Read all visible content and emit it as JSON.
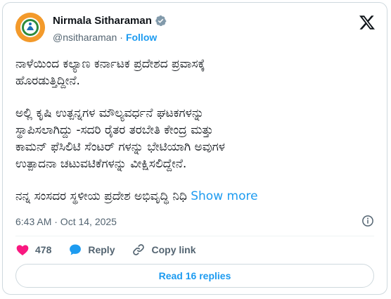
{
  "author": {
    "name": "Nirmala Sitharaman",
    "handle": "@nsitharaman",
    "separator": "·",
    "follow_label": "Follow"
  },
  "post": {
    "paragraphs": [
      "ನಾಳೆಯಿಂದ ಕಲ್ಯಾಣ ಕರ್ನಾಟಕ ಪ್ರದೇಶದ ಪ್ರವಾಸಕ್ಕೆ\nಹೊರಡುತ್ತಿದ್ದೀನೆ.",
      "ಅಲ್ಲಿ ಕೃಷಿ ಉತ್ಪನ್ನಗಳ ಮೌಲ್ಯವರ್ಧನೆ ಘಟಕಗಳನ್ನು\nಸ್ಥಾಪಿಸಲಾಗಿದ್ದು -ಸದರಿ ರೈತರ ತರಬೇತಿ ಕೇಂದ್ರ ಮತ್ತು\nಕಾಮನ್ ಫೆಸಿಲಿಟಿ ಸೆಂಟರ್ ಗಳನ್ನು ಭೇಟಿಯಾಗಿ ಅವುಗಳ\nಉತ್ಪಾದನಾ ಚಟುವಟಿಕೆಗಳನ್ನು ವೀಕ್ಷಿಸಲಿದ್ದೇನೆ."
    ],
    "truncated_line": "ನನ್ನ ಸಂಸದರ ಸ್ಥಳೀಯ ಪ್ರದೇಶ ಅಭಿವೃದ್ಧಿ ನಿಧಿ",
    "show_more_label": "Show more",
    "timestamp": "6:43 AM · Oct 14, 2025"
  },
  "actions": {
    "likes": "478",
    "reply_label": "Reply",
    "copy_link_label": "Copy link"
  },
  "read_replies_label": "Read 16 replies",
  "colors": {
    "accent": "#1d9bf0",
    "like": "#f91880",
    "muted": "#536471",
    "avatar_bg": "#f39a2b"
  },
  "icons": [
    "verified-badge-icon",
    "x-logo-icon",
    "info-icon",
    "heart-icon",
    "reply-bubble-icon",
    "link-icon"
  ]
}
